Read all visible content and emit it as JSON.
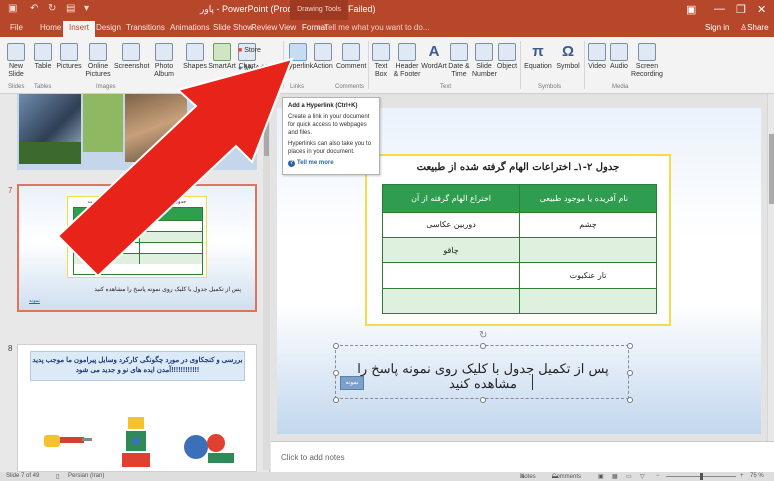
{
  "titlebar": {
    "title": "پاور - PowerPoint (Product Activation Failed)",
    "context_tools": "Drawing Tools",
    "min": "—",
    "restore": "❐",
    "close": "✕"
  },
  "tabs": [
    {
      "label": "File"
    },
    {
      "label": "Home"
    },
    {
      "label": "Insert"
    },
    {
      "label": "Design"
    },
    {
      "label": "Transitions"
    },
    {
      "label": "Animations"
    },
    {
      "label": "Slide Show"
    },
    {
      "label": "Review"
    },
    {
      "label": "View"
    },
    {
      "label": "Format"
    }
  ],
  "tell_me": "Tell me what you want to do...",
  "sign_in": "Sign in",
  "share": "Share",
  "ribbon": {
    "new_slide": "New Slide",
    "table": "Table",
    "pictures": "Pictures",
    "online_pictures": "Online Pictures",
    "screenshot": "Screenshot",
    "photo_album": "Photo Album",
    "shapes": "Shapes",
    "smartart": "SmartArt",
    "chart": "Chart",
    "store": "Store",
    "my_addins": "My Add-ins",
    "hyperlink": "Hyperlink",
    "action": "Action",
    "comment": "Comment",
    "textbox": "Text Box",
    "header_footer": "Header & Footer",
    "wordart": "WordArt",
    "datetime": "Date & Time",
    "slide_number": "Slide Number",
    "object": "Object",
    "equation": "Equation",
    "symbol": "Symbol",
    "video": "Video",
    "audio": "Audio",
    "screen_recording": "Screen Recording",
    "groups": {
      "slides": "Slides",
      "tables": "Tables",
      "images": "Images",
      "illustrations": "Illustrations",
      "links": "Links",
      "comments": "Comments",
      "text": "Text",
      "symbols": "Symbols",
      "media": "Media"
    }
  },
  "tooltip": {
    "title": "Add a Hyperlink (Ctrl+K)",
    "p1": "Create a link in your document for quick access to webpages and files.",
    "p2": "Hyperlinks can also take you to places in your document.",
    "more": "Tell me more"
  },
  "thumbnails": {
    "num7": "7",
    "num8": "8",
    "t7_title": "جدول ۲-۱ـ اختراعات الهام گرفته شده از طبیعت",
    "t7_caption": "پس از تکمیل جدول با کلیک روی نمونه پاسخ را مشاهده کنید",
    "t7_link": "نمونه",
    "t8_heading": "بررسی و کنجکاوی در مورد چگونگی کارکرد وسایل پیرامون ما موجب پدید آمدن ایده های نو و جدید می شود!!!!!!!!!!!!"
  },
  "slide": {
    "table_title": "جدول ۲-۱ـ اختراعات الهام گرفته شده از طبیعت",
    "col_nature": "نام آفریده یا موجود طبیعی",
    "col_invention": "اختراع الهام گرفته از آن",
    "rows": [
      {
        "nature": "چشم",
        "invention": "دوربین عکاسی"
      },
      {
        "nature": "",
        "invention": "چاقو"
      },
      {
        "nature": "تار عنکبوت",
        "invention": ""
      },
      {
        "nature": "",
        "invention": ""
      }
    ],
    "caption": "پس از تکمیل جدول با کلیک روی نمونه پاسخ را مشاهده کنید",
    "answer_link": "نمونه"
  },
  "notes_placeholder": "Click to add notes",
  "status": {
    "slide_of": "Slide 7 of 49",
    "language": "Persian (Iran)",
    "notes": "Notes",
    "comments": "Comments",
    "zoom": "75 %"
  },
  "colors": {
    "accent": "#b7472a",
    "arrow": "#e8231a",
    "table_header": "#2f9d4f"
  }
}
